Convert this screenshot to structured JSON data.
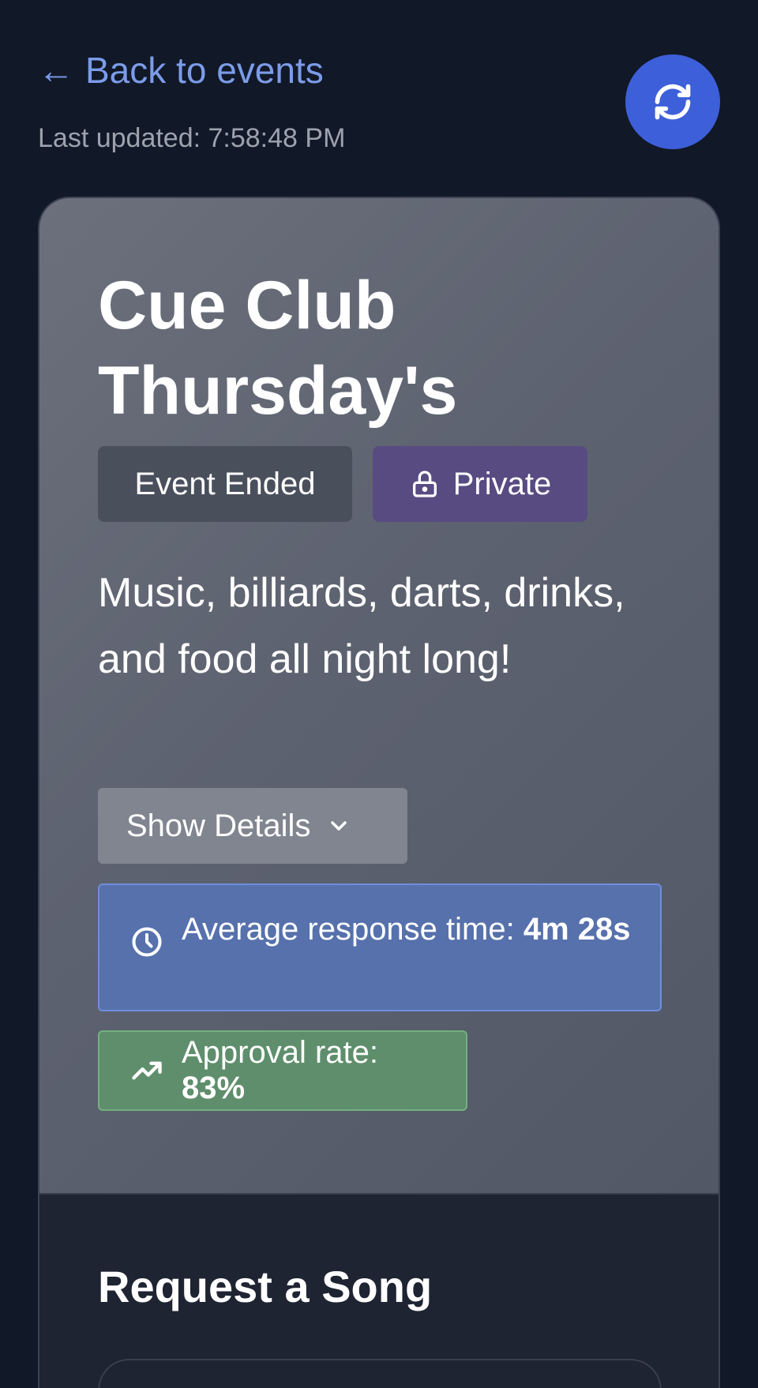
{
  "header": {
    "back_arrow": "←",
    "back_label": "Back to events",
    "last_updated": "Last updated: 7:58:48 PM"
  },
  "event": {
    "title": "Cue Club Thursday's",
    "status_badge": "Event Ended",
    "privacy_badge": "Private",
    "description": "Music, billiards, darts, drinks, and food all night long!",
    "details_button": "Show Details",
    "response_time_label": "Average response time: ",
    "response_time_value": "4m 28s",
    "approval_label": "Approval rate: ",
    "approval_value": "83%"
  },
  "request": {
    "title": "Request a Song"
  },
  "icons": {
    "refresh": "refresh-icon",
    "lock": "lock-icon",
    "chevron": "chevron-down-icon",
    "clock": "clock-icon",
    "trend": "trending-up-icon"
  },
  "colors": {
    "background": "#111827",
    "link": "#7c9ce9",
    "refresh_button": "#3d5fd9",
    "private_badge": "#584b82",
    "response_box": "#5671ac",
    "approval_box": "#5f8e6c"
  }
}
